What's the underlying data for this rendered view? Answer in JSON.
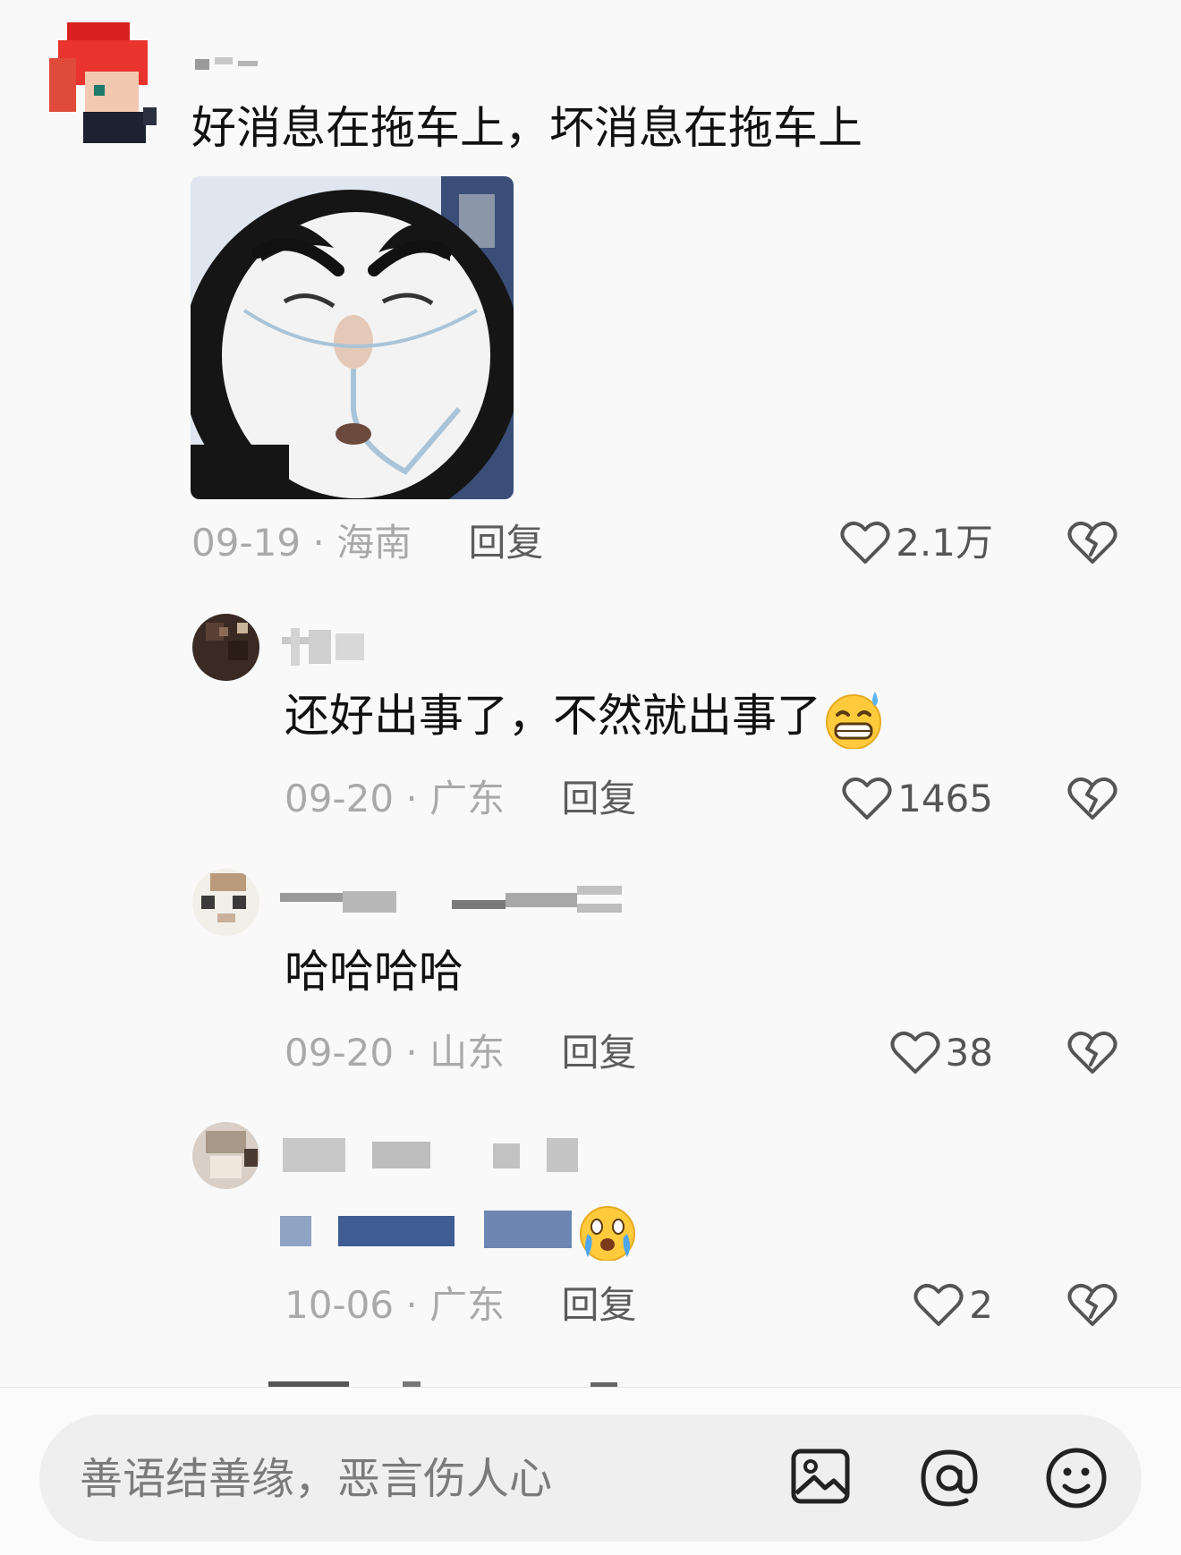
{
  "comments": [
    {
      "text": "好消息在拖车上，坏消息在拖车上",
      "date": "09-19",
      "location": "海南",
      "reply_label": "回复",
      "likes": "2.1万",
      "has_sticker": true
    },
    {
      "text": "还好出事了，不然就出事了",
      "date": "09-20",
      "location": "广东",
      "reply_label": "回复",
      "likes": "1465",
      "emoji": "grin-sweat-icon"
    },
    {
      "text": "哈哈哈哈",
      "date": "09-20",
      "location": "山东",
      "reply_label": "回复",
      "likes": "38"
    },
    {
      "text": "",
      "date": "10-06",
      "location": "广东",
      "reply_label": "回复",
      "likes": "2",
      "emoji": "crying-laugh-icon"
    }
  ],
  "meta_separator": "·",
  "input": {
    "placeholder": "善语结善缘，恶言伤人心",
    "icons": [
      "image-icon",
      "at-icon",
      "emoji-icon"
    ]
  },
  "colors": {
    "background": "#f9f9f9",
    "meta_text": "#a9a9a9",
    "reply_text": "#5c5c5c",
    "input_bg": "#efefef"
  }
}
